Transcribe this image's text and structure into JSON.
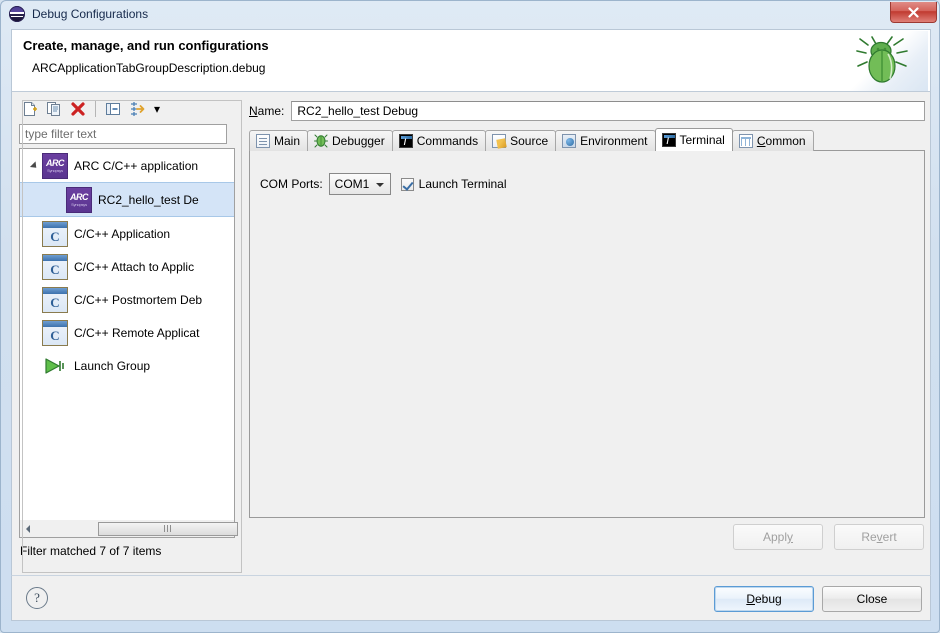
{
  "window": {
    "title": "Debug Configurations",
    "icon": "eclipse-icon",
    "close_label": "✕"
  },
  "header": {
    "title": "Create, manage, and run configurations",
    "subtitle": "ARCApplicationTabGroupDescription.debug",
    "banner_icon": "bug-icon"
  },
  "toolbar": {
    "buttons": [
      {
        "name": "new-configuration-icon",
        "tooltip": "New launch configuration"
      },
      {
        "name": "duplicate-configuration-icon",
        "tooltip": "Duplicate"
      },
      {
        "name": "delete-configuration-icon",
        "tooltip": "Delete"
      },
      {
        "name": "collapse-all-icon",
        "tooltip": "Collapse All"
      },
      {
        "name": "filter-configurations-icon",
        "tooltip": "Filter"
      }
    ],
    "dropdown_arrow": "▾"
  },
  "filter": {
    "placeholder": "type filter text",
    "value": "",
    "status": "Filter matched 7 of 7 items"
  },
  "tree": {
    "items": [
      {
        "label": "ARC C/C++ application",
        "icon": "arc-icon",
        "indent": 0,
        "expanded": true,
        "selected": false
      },
      {
        "label": "RC2_hello_test De",
        "icon": "arc-icon",
        "indent": 1,
        "expanded": false,
        "selected": true
      },
      {
        "label": "C/C++ Application",
        "icon": "c-icon",
        "indent": 0,
        "expanded": false,
        "selected": false
      },
      {
        "label": "C/C++ Attach to Applic",
        "icon": "c-icon",
        "indent": 0,
        "expanded": false,
        "selected": false
      },
      {
        "label": "C/C++ Postmortem Deb",
        "icon": "c-icon",
        "indent": 0,
        "expanded": false,
        "selected": false
      },
      {
        "label": "C/C++ Remote Applicat",
        "icon": "c-icon",
        "indent": 0,
        "expanded": false,
        "selected": false
      },
      {
        "label": "Launch Group",
        "icon": "launch-group-icon",
        "indent": 0,
        "expanded": false,
        "selected": false
      }
    ]
  },
  "name_field": {
    "label_pre": "N",
    "label_post": "ame:",
    "value": "RC2_hello_test Debug"
  },
  "tabs": [
    {
      "label": "Main",
      "icon": "document-icon",
      "active": false,
      "mnemonic": ""
    },
    {
      "label": "Debugger",
      "icon": "bug-icon",
      "active": false,
      "mnemonic": ""
    },
    {
      "label": "Commands",
      "icon": "terminal-icon",
      "active": false,
      "mnemonic": ""
    },
    {
      "label": "Source",
      "icon": "source-icon",
      "active": false,
      "mnemonic": ""
    },
    {
      "label": "Environment",
      "icon": "environment-icon",
      "active": false,
      "mnemonic": ""
    },
    {
      "label": "Terminal",
      "icon": "terminal-icon",
      "active": true,
      "mnemonic": ""
    },
    {
      "label": "Common",
      "icon": "table-icon",
      "active": false,
      "mnemonic": "C"
    }
  ],
  "terminal_tab": {
    "com_ports_label": "COM Ports:",
    "com_ports_value": "COM1",
    "com_ports_options": [
      "COM1"
    ],
    "launch_terminal_label": "Launch Terminal",
    "launch_terminal_checked": true
  },
  "actions": {
    "apply_label": "Apply",
    "apply_mnemonic": "y",
    "apply_enabled": false,
    "revert_label": "Revert",
    "revert_mnemonic": "v",
    "revert_enabled": false
  },
  "footer": {
    "help_label": "?",
    "debug_label": "Debug",
    "debug_mnemonic": "D",
    "close_label": "Close"
  },
  "colors": {
    "accent": "#5b9bd5",
    "selection": "#d4e4f7",
    "arc_purple": "#5a3590",
    "delete_red": "#cc2222",
    "title_bg": "#dfeaf5"
  }
}
